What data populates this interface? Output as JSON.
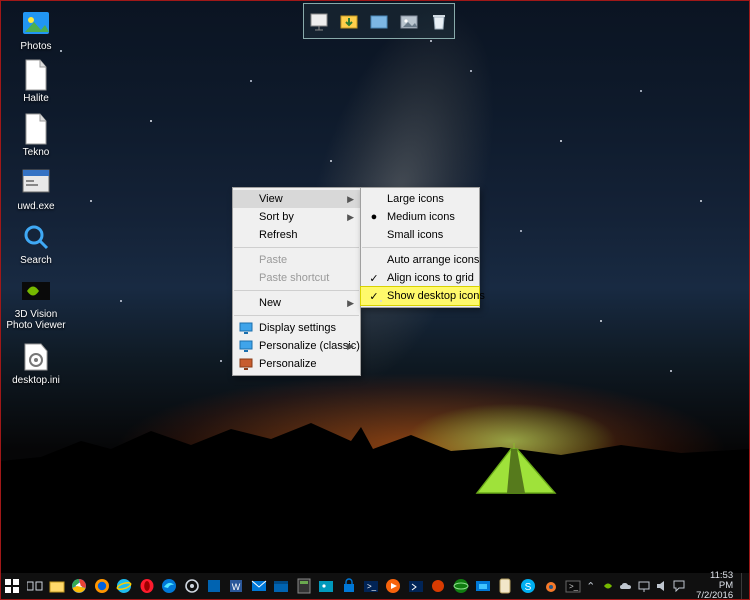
{
  "desktop_icons": [
    {
      "name": "photos",
      "label": "Photos"
    },
    {
      "name": "halite",
      "label": "Halite"
    },
    {
      "name": "tekno",
      "label": "Tekno"
    },
    {
      "name": "uwd",
      "label": "uwd.exe"
    },
    {
      "name": "search",
      "label": "Search"
    },
    {
      "name": "3dvision",
      "label": "3D Vision Photo Viewer"
    },
    {
      "name": "desktopini",
      "label": "desktop.ini"
    }
  ],
  "shelf_items": [
    "presentation",
    "downloads",
    "documents",
    "pictures",
    "recycle-bin"
  ],
  "context_menu": {
    "items": [
      {
        "label": "View",
        "submenu": true,
        "hover": true
      },
      {
        "label": "Sort by",
        "submenu": true
      },
      {
        "label": "Refresh"
      },
      {
        "sep": true
      },
      {
        "label": "Paste",
        "disabled": true
      },
      {
        "label": "Paste shortcut",
        "disabled": true
      },
      {
        "sep": true
      },
      {
        "label": "New",
        "submenu": true
      },
      {
        "sep": true
      },
      {
        "label": "Display settings",
        "icon": "monitor"
      },
      {
        "label": "Personalize (classic)",
        "icon": "monitor",
        "submenu": true
      },
      {
        "label": "Personalize",
        "icon": "personalize"
      }
    ]
  },
  "submenu_view": {
    "items": [
      {
        "label": "Large icons"
      },
      {
        "label": "Medium icons",
        "mark": "●"
      },
      {
        "label": "Small icons"
      },
      {
        "sep": true
      },
      {
        "label": "Auto arrange icons"
      },
      {
        "label": "Align icons to grid",
        "mark": "✓"
      },
      {
        "label": "Show desktop icons",
        "mark": "✓",
        "highlight": true
      }
    ]
  },
  "taskbar": {
    "apps": [
      "start",
      "taskview",
      "explorer",
      "chrome",
      "firefox",
      "ie",
      "opera",
      "edge",
      "settings",
      "calculator-a",
      "word",
      "mail",
      "calendar",
      "calculator-b",
      "photos",
      "store",
      "terminal-a",
      "media",
      "terminal-b",
      "speedfan",
      "globe",
      "remote",
      "mahjong",
      "skype",
      "blender",
      "terminal-c"
    ]
  },
  "tray": {
    "icons": [
      "up",
      "nvidia",
      "onedrive",
      "network",
      "volume",
      "action-center"
    ],
    "time": "11:53 PM",
    "date": "7/2/2016"
  },
  "colors": {
    "chrome": "#f0f0f0",
    "menu_hover": "#d8d8d8",
    "highlight": "#fff96b",
    "taskbar": "#101010"
  }
}
